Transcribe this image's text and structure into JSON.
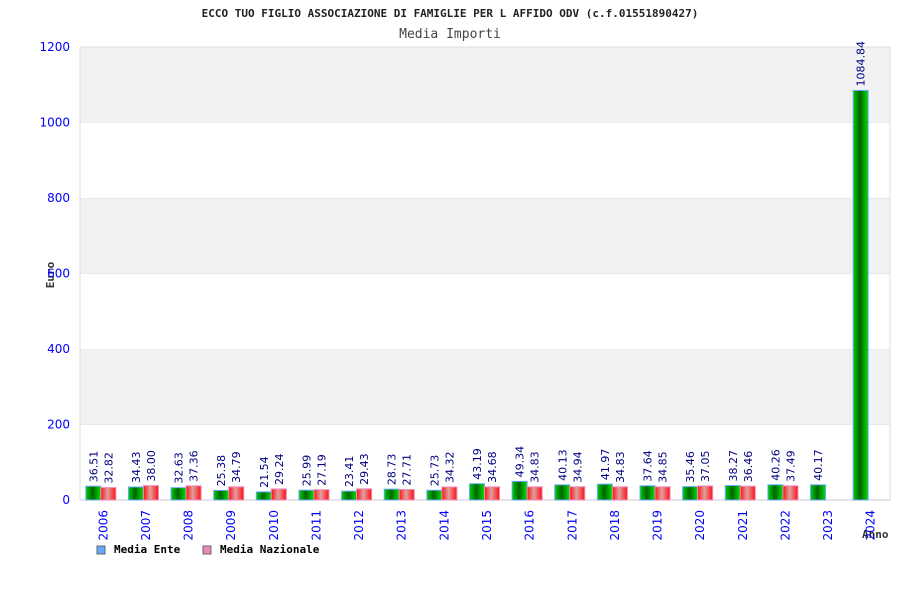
{
  "chart_data": {
    "type": "bar",
    "title": "ECCO TUO FIGLIO ASSOCIAZIONE DI FAMIGLIE PER L AFFIDO ODV (c.f.01551890427)",
    "subtitle": "Media Importi",
    "xlabel": "Anno",
    "ylabel": "Euro",
    "ylim": [
      0,
      1200
    ],
    "yticks": [
      "0",
      "200",
      "400",
      "600",
      "800",
      "1000",
      "1200"
    ],
    "grid": "alternating horizontal bands",
    "legend_position": "bottom-left",
    "categories": [
      "2006",
      "2007",
      "2008",
      "2009",
      "2010",
      "2011",
      "2012",
      "2013",
      "2014",
      "2015",
      "2016",
      "2017",
      "2018",
      "2019",
      "2020",
      "2021",
      "2022",
      "2023",
      "2024"
    ],
    "series": [
      {
        "name": "Media Ente",
        "color": "#00c000",
        "legend_color": "#66aaff",
        "values": [
          36.51,
          34.43,
          32.63,
          25.38,
          21.54,
          25.99,
          23.41,
          28.73,
          25.73,
          43.19,
          49.34,
          40.13,
          41.97,
          37.64,
          35.46,
          38.27,
          40.26,
          40.17,
          1084.84
        ],
        "labels": [
          "36.51",
          "34.43",
          "32.63",
          "25.38",
          "21.54",
          "25.99",
          "23.41",
          "28.73",
          "25.73",
          "43.19",
          "49.34",
          "40.13",
          "41.97",
          "37.64",
          "35.46",
          "38.27",
          "40.26",
          "40.17",
          "1084.84"
        ]
      },
      {
        "name": "Media Nazionale",
        "color": "#ff2020",
        "legend_color": "#ee88bb",
        "values": [
          32.82,
          38.0,
          37.36,
          34.79,
          29.24,
          27.19,
          29.43,
          27.71,
          34.32,
          34.68,
          34.83,
          34.94,
          34.83,
          34.85,
          37.05,
          36.46,
          37.49,
          null,
          null
        ],
        "labels": [
          "32.82",
          "38.00",
          "37.36",
          "34.79",
          "29.24",
          "27.19",
          "29.43",
          "27.71",
          "34.32",
          "34.68",
          "34.83",
          "34.94",
          "34.83",
          "34.85",
          "37.05",
          "36.46",
          "37.49",
          "",
          ""
        ]
      }
    ]
  }
}
